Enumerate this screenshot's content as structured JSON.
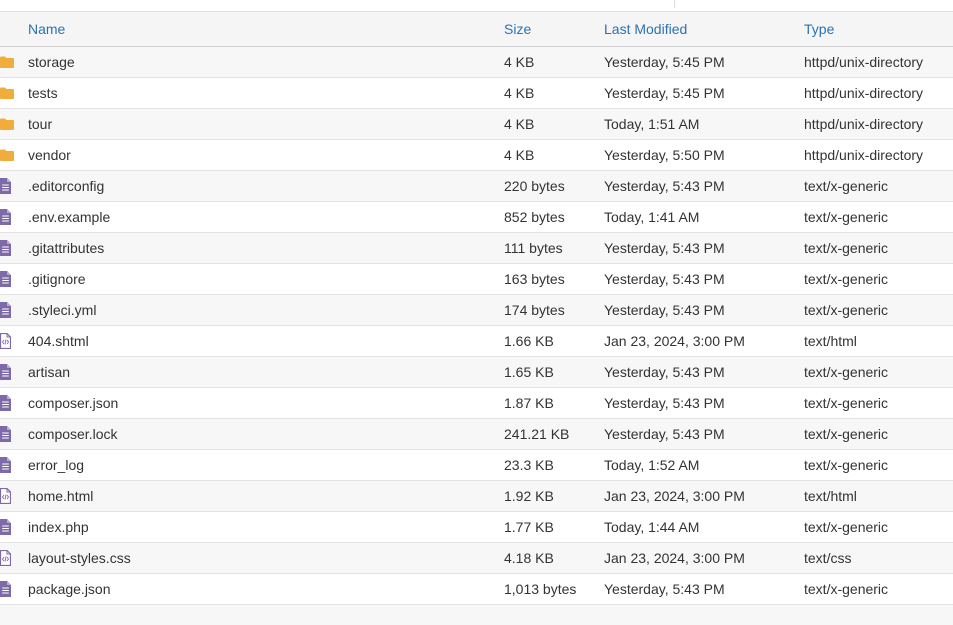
{
  "header": {
    "name": "Name",
    "size": "Size",
    "modified": "Last Modified",
    "type": "Type"
  },
  "colors": {
    "folder": "#f0ad3c",
    "file": "#7e6aa8",
    "header_link": "#2b72b5"
  },
  "rows": [
    {
      "icon": "folder-icon",
      "name": "storage",
      "size": "4 KB",
      "modified": "Yesterday, 5:45 PM",
      "type": "httpd/unix-directory"
    },
    {
      "icon": "folder-icon",
      "name": "tests",
      "size": "4 KB",
      "modified": "Yesterday, 5:45 PM",
      "type": "httpd/unix-directory"
    },
    {
      "icon": "folder-icon",
      "name": "tour",
      "size": "4 KB",
      "modified": "Today, 1:51 AM",
      "type": "httpd/unix-directory"
    },
    {
      "icon": "folder-icon",
      "name": "vendor",
      "size": "4 KB",
      "modified": "Yesterday, 5:50 PM",
      "type": "httpd/unix-directory"
    },
    {
      "icon": "text-file-icon",
      "name": ".editorconfig",
      "size": "220 bytes",
      "modified": "Yesterday, 5:43 PM",
      "type": "text/x-generic"
    },
    {
      "icon": "text-file-icon",
      "name": ".env.example",
      "size": "852 bytes",
      "modified": "Today, 1:41 AM",
      "type": "text/x-generic"
    },
    {
      "icon": "text-file-icon",
      "name": ".gitattributes",
      "size": "111 bytes",
      "modified": "Yesterday, 5:43 PM",
      "type": "text/x-generic"
    },
    {
      "icon": "text-file-icon",
      "name": ".gitignore",
      "size": "163 bytes",
      "modified": "Yesterday, 5:43 PM",
      "type": "text/x-generic"
    },
    {
      "icon": "text-file-icon",
      "name": ".styleci.yml",
      "size": "174 bytes",
      "modified": "Yesterday, 5:43 PM",
      "type": "text/x-generic"
    },
    {
      "icon": "code-file-icon",
      "name": "404.shtml",
      "size": "1.66 KB",
      "modified": "Jan 23, 2024, 3:00 PM",
      "type": "text/html"
    },
    {
      "icon": "text-file-icon",
      "name": "artisan",
      "size": "1.65 KB",
      "modified": "Yesterday, 5:43 PM",
      "type": "text/x-generic"
    },
    {
      "icon": "text-file-icon",
      "name": "composer.json",
      "size": "1.87 KB",
      "modified": "Yesterday, 5:43 PM",
      "type": "text/x-generic"
    },
    {
      "icon": "text-file-icon",
      "name": "composer.lock",
      "size": "241.21 KB",
      "modified": "Yesterday, 5:43 PM",
      "type": "text/x-generic"
    },
    {
      "icon": "text-file-icon",
      "name": "error_log",
      "size": "23.3 KB",
      "modified": "Today, 1:52 AM",
      "type": "text/x-generic"
    },
    {
      "icon": "code-file-icon",
      "name": "home.html",
      "size": "1.92 KB",
      "modified": "Jan 23, 2024, 3:00 PM",
      "type": "text/html"
    },
    {
      "icon": "text-file-icon",
      "name": "index.php",
      "size": "1.77 KB",
      "modified": "Today, 1:44 AM",
      "type": "text/x-generic"
    },
    {
      "icon": "code-file-icon",
      "name": "layout-styles.css",
      "size": "4.18 KB",
      "modified": "Jan 23, 2024, 3:00 PM",
      "type": "text/css"
    },
    {
      "icon": "text-file-icon",
      "name": "package.json",
      "size": "1,013 bytes",
      "modified": "Yesterday, 5:43 PM",
      "type": "text/x-generic"
    }
  ]
}
